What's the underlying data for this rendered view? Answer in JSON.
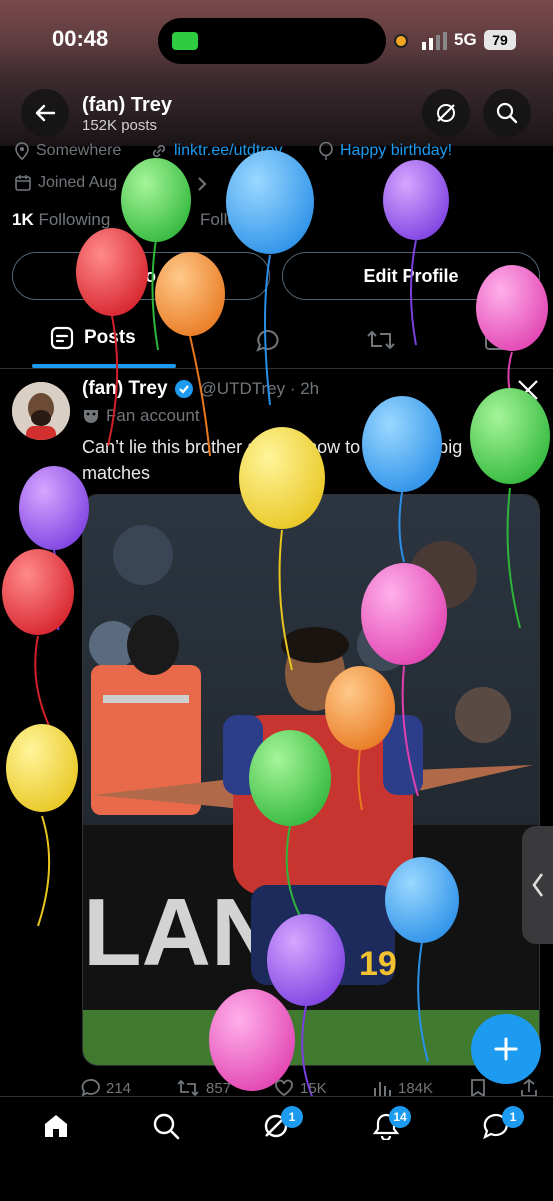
{
  "status": {
    "time": "00:48",
    "network": "5G",
    "battery": "79"
  },
  "header": {
    "name": "(fan) Trey",
    "posts": "152K posts"
  },
  "profile": {
    "location": "Somewhere",
    "link": "linktr.ee/utdtrey",
    "birthday": "Happy birthday!",
    "joined": "Joined Aug",
    "following_count": "1K",
    "following_label": "Following",
    "followers_label": "Followers",
    "edit_profile": "Edit Profile",
    "left_button": "Pro"
  },
  "tabs": {
    "posts": "Posts"
  },
  "tweet": {
    "name": "(fan) Trey",
    "handle": "@UTDTrey · 2h",
    "label": "Fan account",
    "text": "Can’t lie this brother always how to be big in big matches",
    "replies": "214",
    "reposts": "857",
    "likes": "15K",
    "views": "184K"
  },
  "nav": {
    "chat_badge": "1",
    "notif_badge": "14",
    "msg_badge": "1"
  },
  "colors": {
    "accent": "#1d9bf0",
    "background": "#000000"
  },
  "icons": [
    "back-arrow-icon",
    "grok-icon",
    "search-icon",
    "location-icon",
    "link-icon",
    "balloon-icon",
    "calendar-icon",
    "chevron-right-icon",
    "posts-icon",
    "reply-icon",
    "repost-icon",
    "x-logo-icon",
    "verified-icon",
    "views-icon",
    "bookmark-icon",
    "share-icon",
    "home-icon",
    "notifications-icon",
    "messages-icon",
    "plus-icon",
    "handle-chevron-icon"
  ]
}
